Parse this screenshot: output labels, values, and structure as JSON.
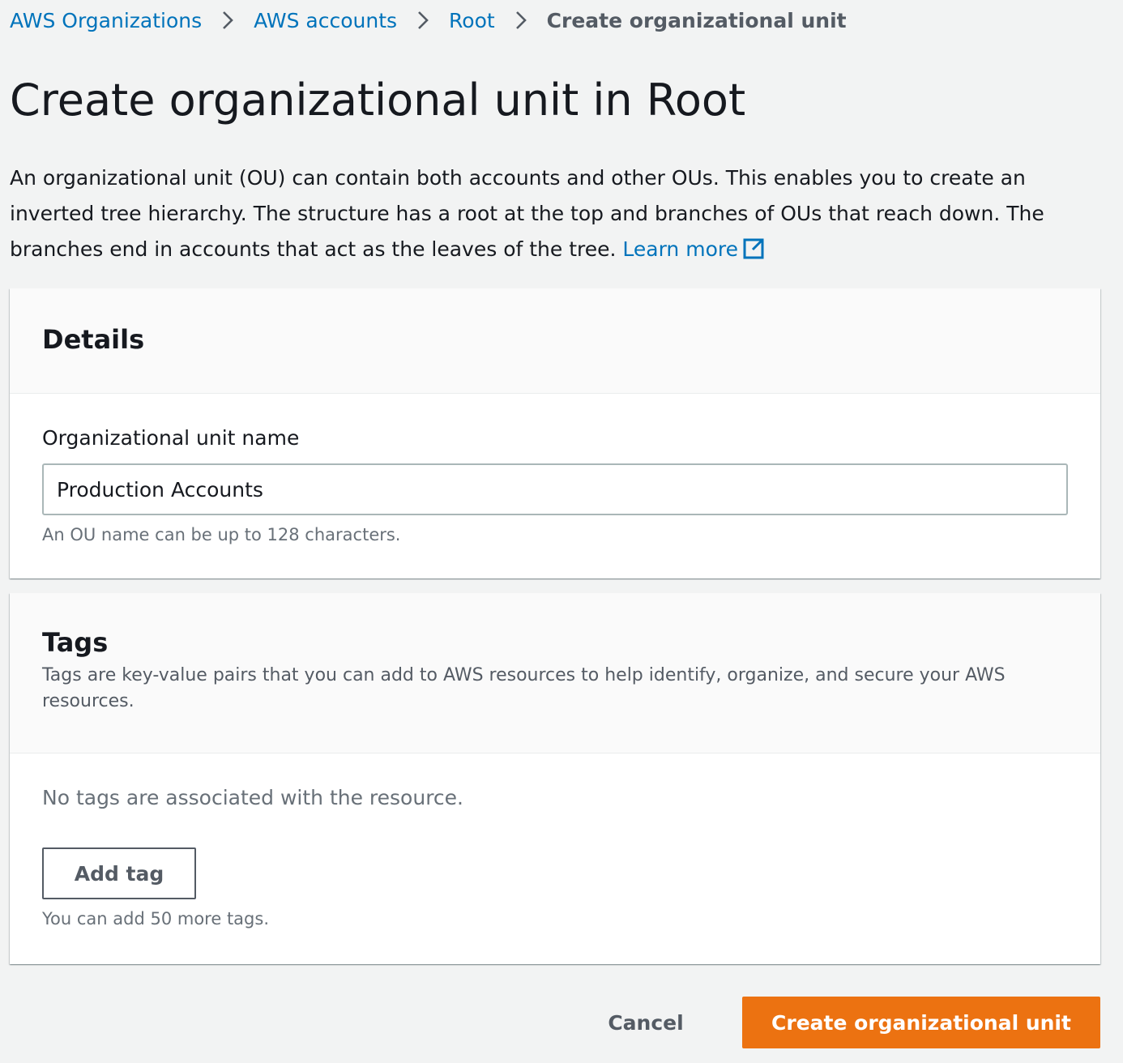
{
  "breadcrumb": {
    "items": [
      "AWS Organizations",
      "AWS accounts",
      "Root"
    ],
    "current": "Create organizational unit"
  },
  "page": {
    "title": "Create organizational unit in Root",
    "intro": "An organizational unit (OU) can contain both accounts and other OUs. This enables you to create an inverted tree hierarchy. The structure has a root at the top and branches of OUs that reach down. The branches end in accounts that act as the leaves of the tree.",
    "learn_more": "Learn more",
    "learn_more_icon": "external-link-icon"
  },
  "details": {
    "title": "Details",
    "field_label": "Organizational unit name",
    "field_value": "Production Accounts",
    "field_hint": "An OU name can be up to 128 characters."
  },
  "tags": {
    "title": "Tags",
    "description": "Tags are key-value pairs that you can add to AWS resources to help identify, organize, and secure your AWS resources.",
    "empty_text": "No tags are associated with the resource.",
    "add_button": "Add tag",
    "hint": "You can add 50 more tags."
  },
  "footer": {
    "cancel": "Cancel",
    "submit": "Create organizational unit"
  },
  "colors": {
    "link": "#0073bb",
    "primary": "#ec7211",
    "background": "#f2f3f3"
  }
}
